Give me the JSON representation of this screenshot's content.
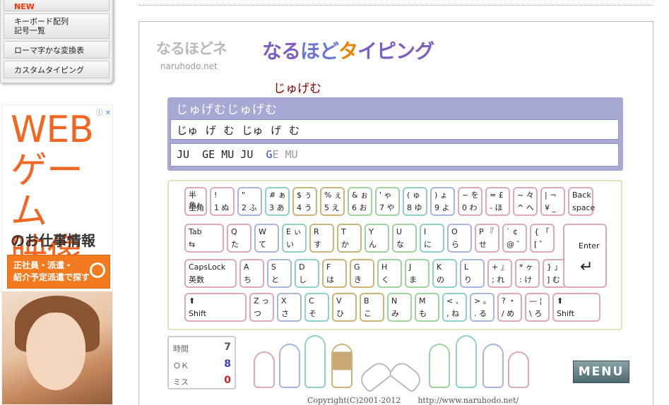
{
  "sidebar": {
    "items": [
      {
        "label": "NEW"
      },
      {
        "label": "キーボード配列\n記号一覧"
      },
      {
        "label": "ローマ字かな変換表"
      },
      {
        "label": "カスタムタイピング"
      }
    ]
  },
  "ad": {
    "info": "ⓘ ✕",
    "headline": "WEB\nゲーム\n映像",
    "subline": "のお仕事情報",
    "button": "正社員・派遣・\n紹介予定派遣で探す"
  },
  "logo": {
    "small_main": "なるほどネ",
    "small_sub": "naruhodo.net",
    "big": [
      "なる",
      "ほど",
      "タ",
      "イピング"
    ]
  },
  "typing": {
    "current_word": "じゅげむ",
    "kanji_line": "じゅげむじゅげむ",
    "kana_line": "じゅ げ む じゅ げ む",
    "roma_typed": "JU  GE MU JU  ",
    "roma_cursor": "G",
    "roma_pending": "E MU"
  },
  "keyboard": {
    "colors": {
      "pink": "#dba9b7",
      "blue": "#a8b6dc",
      "teal": "#8fd0c8",
      "tan": "#c9b47a",
      "green": "#9ed29e"
    },
    "row1": [
      {
        "t": "半角/",
        "b": "全角"
      },
      {
        "t": "!",
        "b": "1 ぬ"
      },
      {
        "t": "\"",
        "b": "2 ふ"
      },
      {
        "t": "# ぁ",
        "b": "3 あ"
      },
      {
        "t": "$ ぅ",
        "b": "4 う"
      },
      {
        "t": "% ぇ",
        "b": "5 え"
      },
      {
        "t": "& ぉ",
        "b": "6 お"
      },
      {
        "t": "' ゃ",
        "b": "7 や"
      },
      {
        "t": "( ゅ",
        "b": "8 ゆ"
      },
      {
        "t": ") ょ",
        "b": "9 よ"
      },
      {
        "t": "~ を",
        "b": "0 わ"
      },
      {
        "t": "= £",
        "b": "- ほ"
      },
      {
        "t": "~ 々",
        "b": "^ へ"
      },
      {
        "t": "| ¬",
        "b": "¥ _"
      },
      {
        "t": "Back",
        "b": "space"
      }
    ],
    "row2": [
      {
        "t": "Tab",
        "b": "⇆"
      },
      {
        "t": "Q",
        "b": "た"
      },
      {
        "t": "W",
        "b": "て"
      },
      {
        "t": "E ぃ",
        "b": "い"
      },
      {
        "t": "R",
        "b": "す"
      },
      {
        "t": "T",
        "b": "か"
      },
      {
        "t": "Y",
        "b": "ん"
      },
      {
        "t": "U",
        "b": "な"
      },
      {
        "t": "I",
        "b": "に"
      },
      {
        "t": "O",
        "b": "ら"
      },
      {
        "t": "P 『",
        "b": "せ"
      },
      {
        "t": "` ¢",
        "b": "@ ゛"
      },
      {
        "t": "{ 「",
        "b": "[ ゜"
      }
    ],
    "row3": [
      {
        "t": "CapsLock",
        "b": "英数"
      },
      {
        "t": "A",
        "b": "ち"
      },
      {
        "t": "S",
        "b": "と"
      },
      {
        "t": "D",
        "b": "し"
      },
      {
        "t": "F",
        "b": "は"
      },
      {
        "t": "G",
        "b": "き"
      },
      {
        "t": "H",
        "b": "く"
      },
      {
        "t": "J",
        "b": "ま"
      },
      {
        "t": "K",
        "b": "の"
      },
      {
        "t": "L",
        "b": "り"
      },
      {
        "t": "+ 』",
        "b": "; れ"
      },
      {
        "t": "* ヶ",
        "b": ": け"
      },
      {
        "t": "} 」",
        "b": "] む"
      }
    ],
    "row4": [
      {
        "t": "⬆",
        "b": "Shift"
      },
      {
        "t": "Z っ",
        "b": "つ"
      },
      {
        "t": "X",
        "b": "さ"
      },
      {
        "t": "C",
        "b": "そ"
      },
      {
        "t": "V",
        "b": "ひ"
      },
      {
        "t": "B",
        "b": "こ"
      },
      {
        "t": "N",
        "b": "み"
      },
      {
        "t": "M",
        "b": "も"
      },
      {
        "t": "< 、",
        "b": ", ね"
      },
      {
        "t": "> 。",
        "b": ". る"
      },
      {
        "t": "? ・",
        "b": "/ め"
      },
      {
        "t": "— ¦",
        "b": "\\ ろ"
      },
      {
        "t": "⬆",
        "b": "Shift"
      }
    ],
    "enter": "Enter"
  },
  "stats": {
    "time_label": "時間",
    "time_value": "7",
    "ok_label": "ＯＫ",
    "ok_value": "8",
    "miss_label": "ミス",
    "miss_value": "0"
  },
  "menu_label": "MENU",
  "footer": {
    "copyright": "Copyright(C)2001-2012",
    "url": "http://www.naruhodo.net/"
  }
}
